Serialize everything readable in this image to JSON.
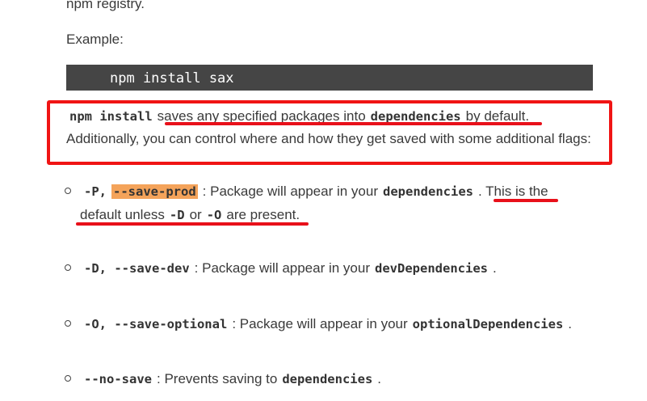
{
  "intro": {
    "registry_tail": "npm registry.",
    "example_label": "Example:",
    "code_command": "npm install sax"
  },
  "boxed_paragraph": {
    "cmd": "npm install",
    "t1": "saves any specified packages into",
    "deps": "dependencies",
    "t2": "by default.",
    "line2": "Additionally, you can control where and how they get saved with some additional flags:"
  },
  "flags": [
    {
      "flag_a": "-P,",
      "flag_b": "--save-prod",
      "desc": ": Package will appear in your",
      "target": "dependencies",
      "end": ". This is the",
      "cont_a": "default unless",
      "cont_d": "-D",
      "cont_or": "or",
      "cont_o": "-O",
      "cont_end": "are present."
    },
    {
      "flag": "-D, --save-dev",
      "desc": ": Package will appear in your",
      "target": "devDependencies",
      "end": "."
    },
    {
      "flag": "-O, --save-optional",
      "desc": ": Package will appear in your",
      "target": "optionalDependencies",
      "end": "."
    },
    {
      "flag": "--no-save",
      "desc": ": Prevents saving to",
      "target": "dependencies",
      "end": "."
    }
  ],
  "colors": {
    "annotation_red": "#f01414",
    "highlight_orange": "#f4a35a",
    "code_block_bg": "#454545"
  }
}
